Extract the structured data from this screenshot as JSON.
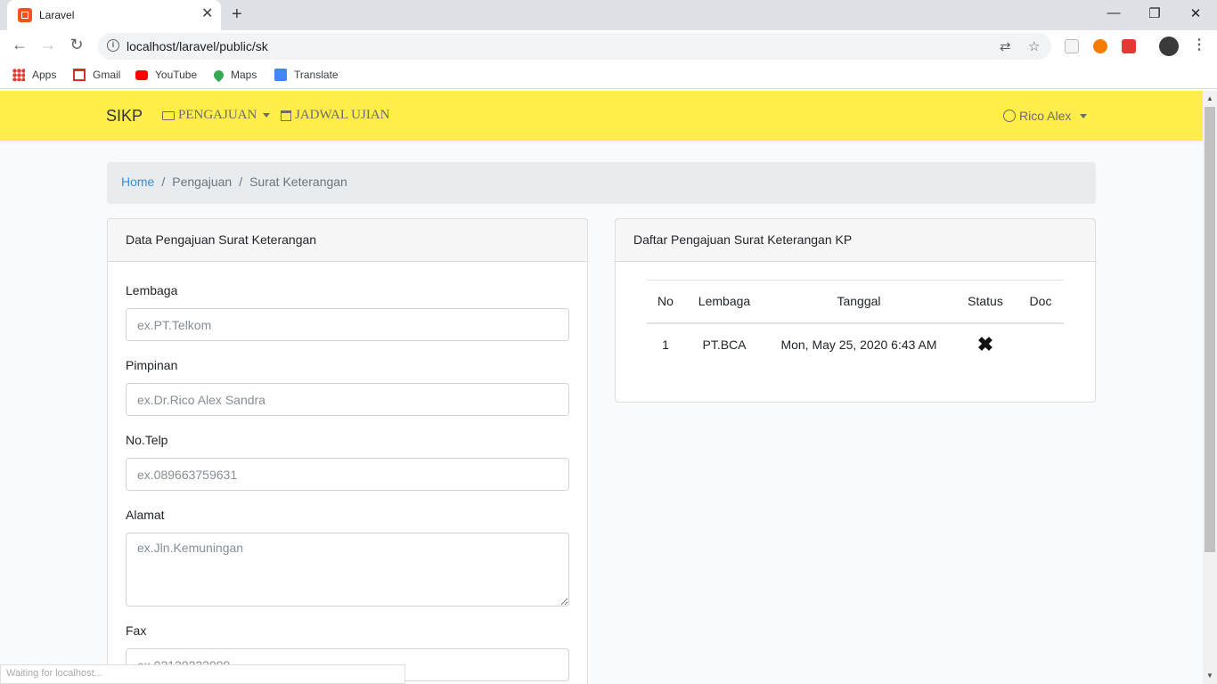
{
  "browser": {
    "tab_title": "Laravel",
    "url": "localhost/laravel/public/sk",
    "bookmarks": [
      "Apps",
      "Gmail",
      "YouTube",
      "Maps",
      "Translate"
    ],
    "status_text": "Waiting for localhost..."
  },
  "navbar": {
    "brand": "SIKP",
    "menu_pengajuan": "PENGAJUAN",
    "menu_jadwal": "JADWAL UJIAN",
    "user": "Rico Alex",
    "bg_color": "#ffed4a"
  },
  "breadcrumb": {
    "home": "Home",
    "pengajuan": "Pengajuan",
    "current": "Surat Keterangan"
  },
  "form_card": {
    "title": "Data Pengajuan Surat Keterangan",
    "fields": [
      {
        "label": "Lembaga",
        "placeholder": "ex.PT.Telkom"
      },
      {
        "label": "Pimpinan",
        "placeholder": "ex.Dr.Rico Alex Sandra"
      },
      {
        "label": "No.Telp",
        "placeholder": "ex.089663759631"
      },
      {
        "label": "Alamat",
        "placeholder": "ex.Jln.Kemuningan"
      },
      {
        "label": "Fax",
        "placeholder": "ex.02129222999"
      }
    ]
  },
  "list_card": {
    "title": "Daftar Pengajuan Surat Keterangan KP",
    "columns": [
      "No",
      "Lembaga",
      "Tanggal",
      "Status",
      "Doc"
    ],
    "rows": [
      {
        "no": "1",
        "lembaga": "PT.BCA",
        "tanggal": "Mon, May 25, 2020 6:43 AM",
        "status": "✖",
        "doc": ""
      }
    ]
  }
}
